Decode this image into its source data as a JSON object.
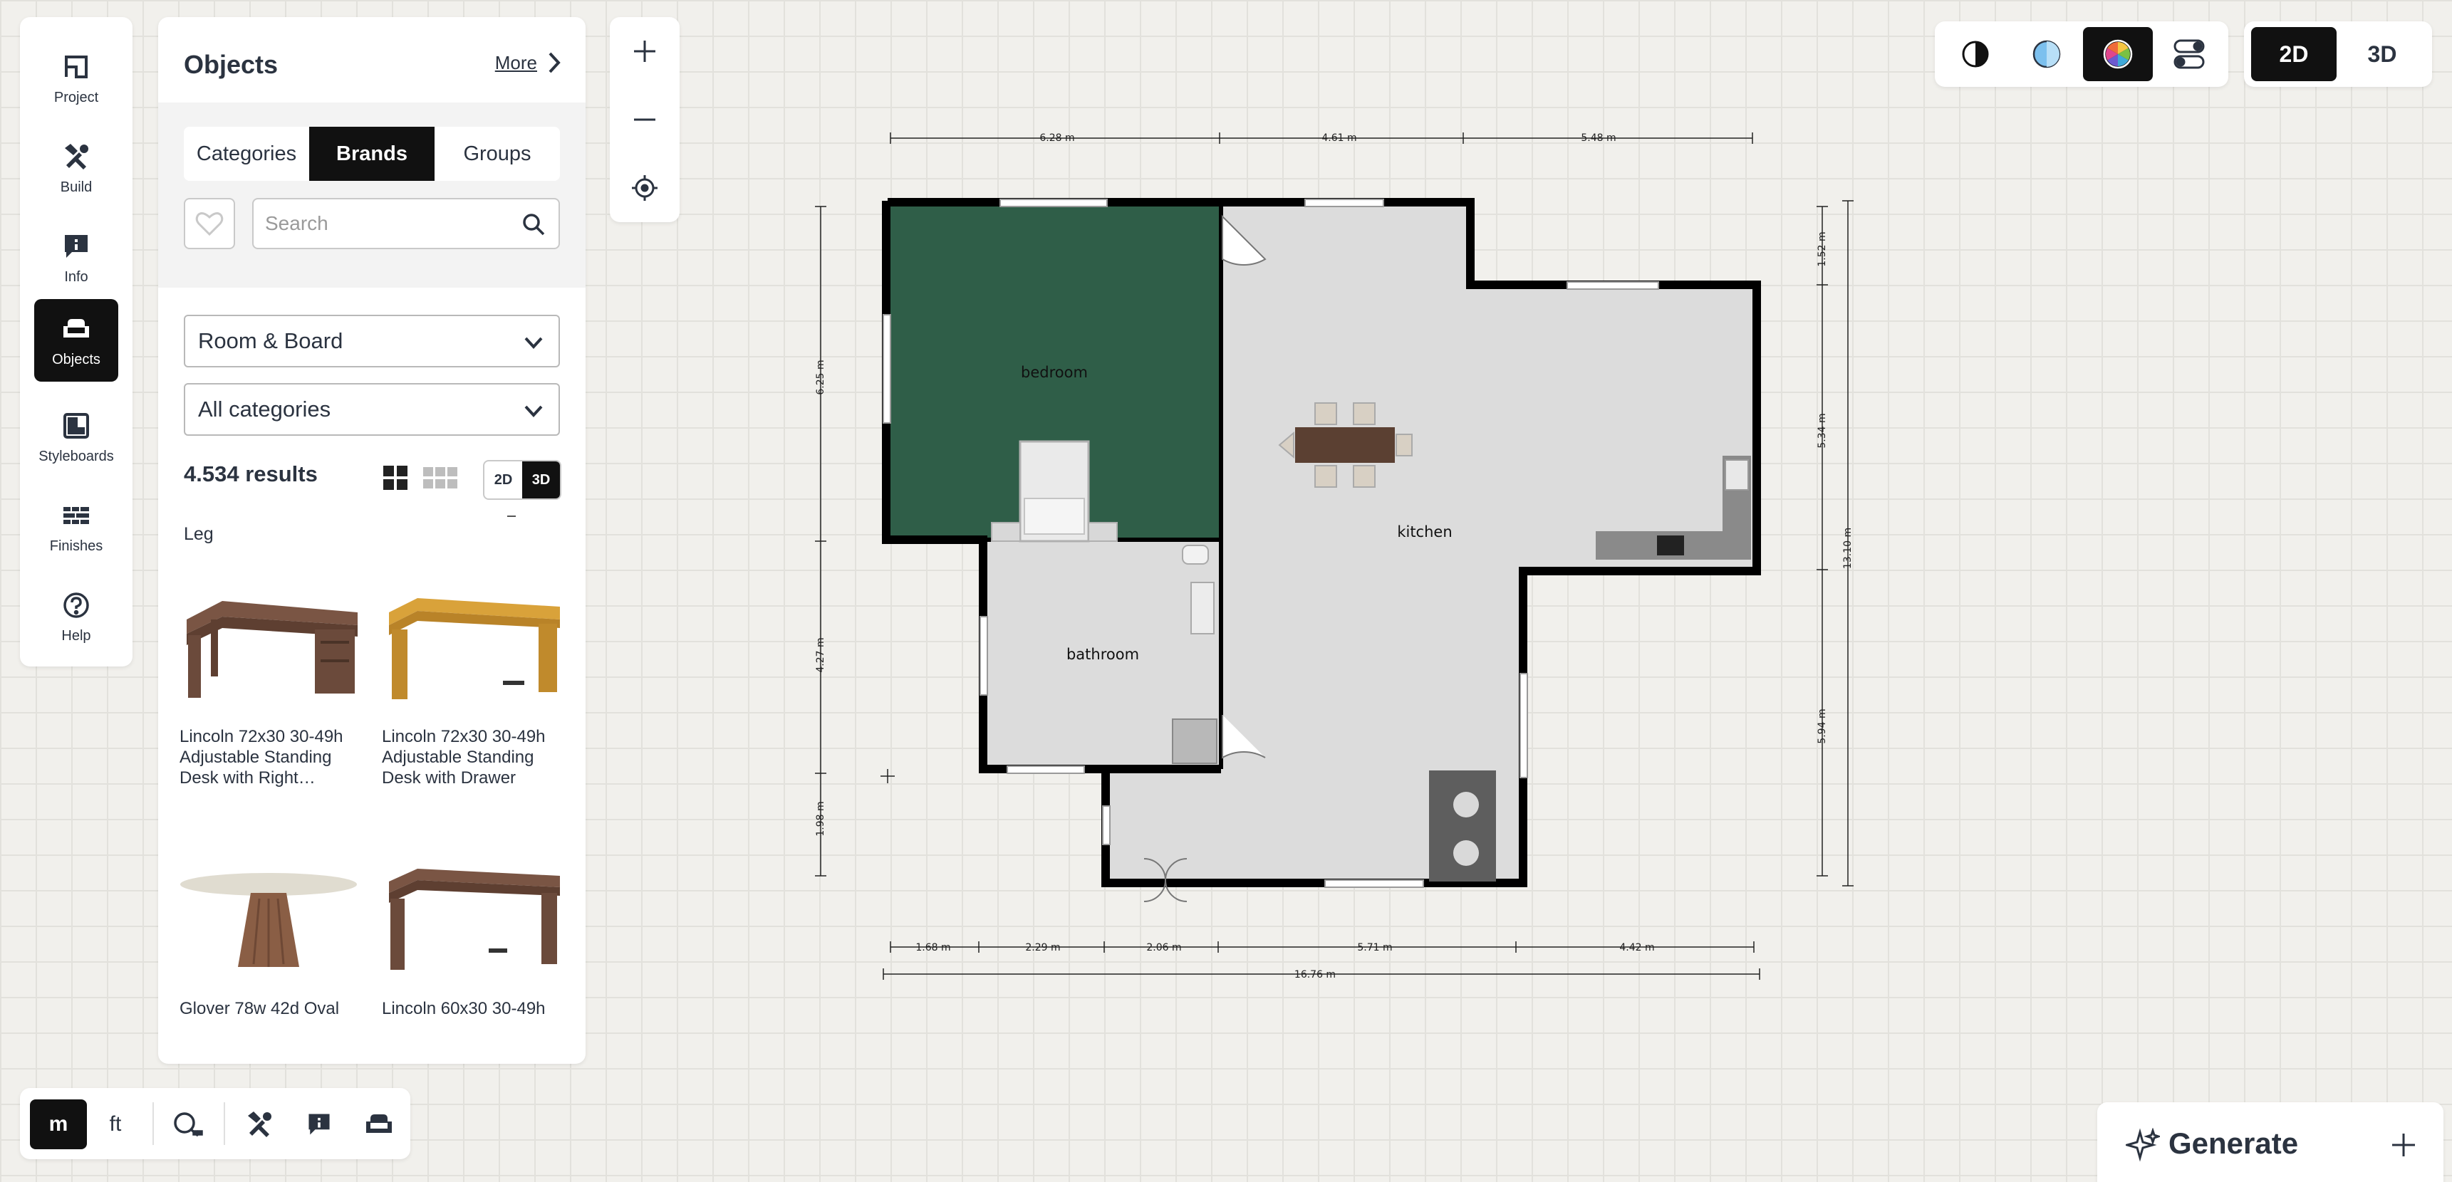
{
  "nav": {
    "items": [
      {
        "label": "Project",
        "icon": "project-icon"
      },
      {
        "label": "Build",
        "icon": "build-icon"
      },
      {
        "label": "Info",
        "icon": "info-icon"
      },
      {
        "label": "Objects",
        "icon": "objects-icon",
        "active": true
      },
      {
        "label": "Styleboards",
        "icon": "styleboards-icon"
      },
      {
        "label": "Finishes",
        "icon": "finishes-icon"
      },
      {
        "label": "Help",
        "icon": "help-icon"
      }
    ]
  },
  "objects": {
    "title": "Objects",
    "more_label": "More",
    "tabs": [
      {
        "label": "Categories"
      },
      {
        "label": "Brands",
        "selected": true
      },
      {
        "label": "Groups"
      }
    ],
    "search_placeholder": "Search",
    "brand_select": "Room & Board",
    "category_select": "All categories",
    "results_count": "4.534 results",
    "view_2d": "2D",
    "view_3d": "3D",
    "section_label": "Leg",
    "section_dash": "–",
    "products": [
      {
        "name": "Lincoln 72x30 30-49h Adjustable Standing Desk with Right…"
      },
      {
        "name": "Lincoln 72x30 30-49h Adjustable Standing Desk with Drawer"
      },
      {
        "name": "Glover 78w 42d Oval"
      },
      {
        "name": "Lincoln 60x30 30-49h"
      }
    ]
  },
  "view_modes": [
    "contrast-icon",
    "blue-circle-icon",
    "color-wheel-icon",
    "toggle-settings-icon"
  ],
  "dimension_switch": {
    "d2": "2D",
    "d3": "3D",
    "selected": "2D"
  },
  "units": {
    "m": "m",
    "ft": "ft",
    "selected": "m"
  },
  "generate": {
    "label": "Generate"
  },
  "plan": {
    "rooms": [
      "bedroom",
      "bathroom",
      "kitchen"
    ],
    "dimensions": {
      "top": [
        "6.28 m",
        "4.61 m",
        "5.48 m"
      ],
      "bottom": [
        "1.68 m",
        "2.29 m",
        "2.06 m",
        "5.71 m",
        "4.42 m"
      ],
      "total_bottom": "16.76 m",
      "left": [
        "6.25 m",
        "4.27 m",
        "1.98 m"
      ],
      "right": [
        "1.52 m",
        "5.34 m",
        "5.94 m"
      ],
      "right_total": "13.10 m"
    },
    "colors": {
      "bedroom": "#2f5e48",
      "floor": "#dcdcdc",
      "wall": "#000000"
    }
  }
}
